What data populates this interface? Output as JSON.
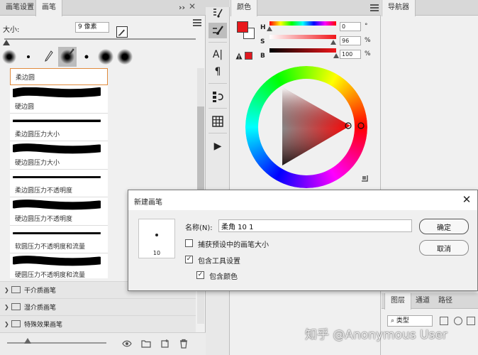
{
  "brush_panel": {
    "tabs": [
      {
        "label": "画笔设置",
        "active": false
      },
      {
        "label": "画笔",
        "active": true
      }
    ],
    "collapse_icon": "double-chevron-right-icon",
    "size_label": "大小:",
    "size_value": "9 像素",
    "presets": [
      {
        "label": "柔边圆"
      },
      {
        "label": "硬边圆"
      },
      {
        "label": "柔边圆压力大小"
      },
      {
        "label": "硬边圆压力大小"
      },
      {
        "label": "柔边圆压力不透明度"
      },
      {
        "label": "硬边圆压力不透明度"
      },
      {
        "label": "软圆压力不透明度和流量"
      },
      {
        "label": "硬圆压力不透明度和流量"
      }
    ],
    "groups": [
      {
        "label": "干介质画笔"
      },
      {
        "label": "湿介质画笔"
      },
      {
        "label": "特殊效果画笔"
      }
    ]
  },
  "color_panel": {
    "tab_label": "颜色",
    "fg_color": "#e8181c",
    "bg_color": "#ffffff",
    "h": {
      "label": "H",
      "value": "0",
      "unit": "°"
    },
    "s": {
      "label": "S",
      "value": "96",
      "unit": "%"
    },
    "b": {
      "label": "B",
      "value": "100",
      "unit": "%"
    }
  },
  "navigator_panel": {
    "tab_label": "导航器",
    "layers_tabs": [
      "图层",
      "通道",
      "路径"
    ],
    "filter_label": "类型"
  },
  "dialog": {
    "title": "新建画笔",
    "preview_size": "10",
    "name_label": "名称(N):",
    "name_value": "柔角 10 1",
    "capture_size_label": "捕获预设中的画笔大小",
    "capture_size_checked": false,
    "include_tool_label": "包含工具设置",
    "include_tool_checked": true,
    "include_color_label": "包含颜色",
    "include_color_checked": true,
    "ok_label": "确定",
    "cancel_label": "取消"
  },
  "watermark": "知乎 @Anonymous User"
}
